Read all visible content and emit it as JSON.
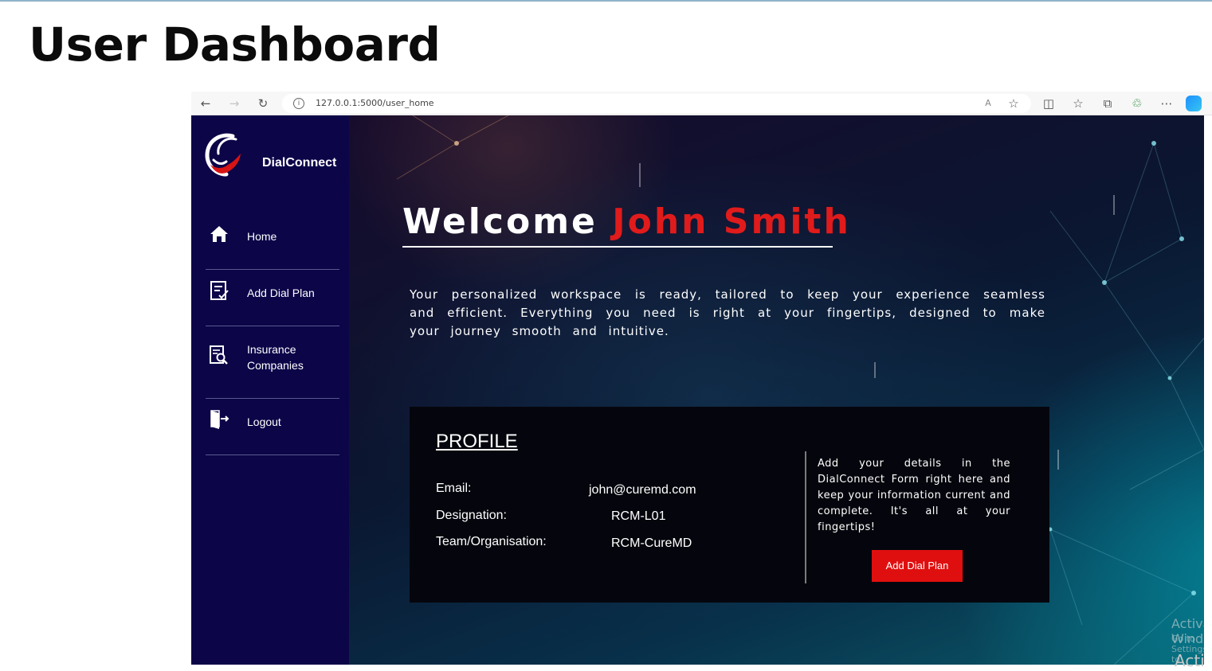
{
  "slide": {
    "title": "User Dashboard"
  },
  "browser": {
    "url": "127.0.0.1:5000/user_home",
    "toolbar_icons": [
      "back-arrow-icon",
      "forward-arrow-icon",
      "reload-icon",
      "read-aloud-icon",
      "favorite-star-icon",
      "split-screen-icon",
      "favorites-icon",
      "collections-icon",
      "extensions-icon",
      "more-icon",
      "copilot-icon"
    ]
  },
  "sidebar": {
    "brand": "DialConnect",
    "items": [
      {
        "label": "Home",
        "icon": "home-icon"
      },
      {
        "label": "Add Dial Plan",
        "icon": "form-checklist-icon"
      },
      {
        "label": "Insurance Companies",
        "icon": "document-search-icon"
      },
      {
        "label": "Logout",
        "icon": "logout-door-icon"
      }
    ]
  },
  "main": {
    "welcome_prefix": "Welcome",
    "user_name": "John Smith",
    "intro": "Your personalized workspace is ready, tailored to keep your experience seamless and efficient. Everything you need is right at your fingertips, designed to make your journey smooth and intuitive.",
    "profile": {
      "title": "PROFILE",
      "email_label": "Email:",
      "email_value": "john@curemd.com",
      "designation_label": "Designation:",
      "designation_value": "RCM-L01",
      "team_label": "Team/Organisation:",
      "team_value": "RCM-CureMD"
    },
    "note": "Add your details in the DialConnect Form right here and keep your information current and complete. It's all at your fingertips!",
    "add_button": "Add Dial Plan"
  },
  "watermark": {
    "line1": "Activate Windows",
    "line2": "Go to Settings to activate Windows.",
    "overflow": "Acti"
  },
  "colors": {
    "sidebar": "#0c0548",
    "accent_red": "#e01b1b",
    "card": "#05060d"
  }
}
